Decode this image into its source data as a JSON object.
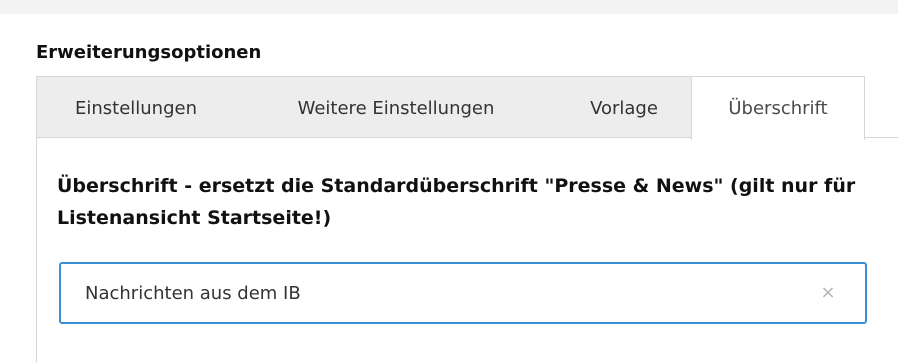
{
  "section": {
    "title": "Erweiterungsoptionen"
  },
  "tabs": [
    {
      "label": "Einstellungen",
      "active": false
    },
    {
      "label": "Weitere Einstellungen",
      "active": false
    },
    {
      "label": "Vorlage",
      "active": false
    },
    {
      "label": "Überschrift",
      "active": true
    }
  ],
  "field": {
    "label": "Überschrift - ersetzt die Standardüberschrift \"Presse & News\" (gilt nur für Listenansicht Startseite!)",
    "value": "Nachrichten aus dem IB",
    "clear_glyph": "×",
    "clear_icon": "close-icon"
  },
  "colors": {
    "focus_border": "#3a8fd6",
    "tab_bar_bg": "#ededed",
    "active_tab_bg": "#ffffff",
    "panel_border": "#d6d6d6"
  }
}
